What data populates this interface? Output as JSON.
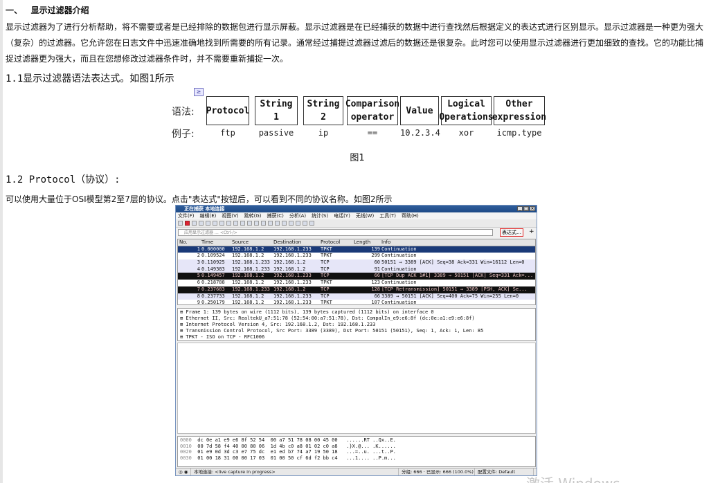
{
  "section": {
    "number": "一、",
    "title": "显示过滤器介绍"
  },
  "intro": "显示过滤器为了进行分析帮助，将不需要或者是已经排除的数据包进行显示屏蔽。显示过滤器是在已经捕获的数据中进行查找然后根据定义的表达式进行区别显示。显示过滤器是一种更为强大（复杂）的过滤器。它允许您在日志文件中迅速准确地找到所需要的所有记录。通常经过捕提过滤器过滤后的数据还是很复杂。此时您可以使用显示过滤器进行更加细致的查找。它的功能比捕捉过滤器更为强大，而且在您想修改过滤器条件时，并不需要重新捕捉一次。",
  "h1_1": "1.1显示过滤器语法表达式。如图1所示",
  "figure1": {
    "syntax_label": "语法:",
    "example_label": "例子:",
    "boxes": [
      {
        "line1": "Protocol",
        "line2": ""
      },
      {
        "line1": "String 1",
        "line2": ""
      },
      {
        "line1": "String 2",
        "line2": ""
      },
      {
        "line1": "Comparison",
        "line2": "operator"
      },
      {
        "line1": "Value",
        "line2": ""
      },
      {
        "line1": "Logical",
        "line2": "Operations"
      },
      {
        "line1": "Other",
        "line2": "expression"
      }
    ],
    "examples": [
      "ftp",
      "passive",
      "ip",
      "==",
      "10.2.3.4",
      "xor",
      "icmp.type"
    ],
    "caption": "图1"
  },
  "h1_2": "1.2 Protocol（协议）:",
  "para2": "可以使用大量位于OSI模型第2至7层的协议。点击\"表达式\"按钮后，可以看到不同的协议名称。如图2所示",
  "wireshark": {
    "title": "正在捕获 本地连接",
    "menu": [
      "文件(F)",
      "编辑(E)",
      "视图(V)",
      "跳转(G)",
      "捕获(C)",
      "分析(A)",
      "统计(S)",
      "电话(Y)",
      "无线(W)",
      "工具(T)",
      "帮助(H)"
    ],
    "filter_placeholder": "应用显示过滤器 … <Ctrl-/>",
    "expr_button": "表达式…",
    "plus": "+",
    "columns": [
      "No.",
      "Time",
      "Source",
      "Destination",
      "Protocol",
      "Length",
      "Info"
    ],
    "packets": [
      {
        "no": "1",
        "time": "0.000000",
        "src": "192.168.1.2",
        "dst": "192.168.1.233",
        "proto": "TPKT",
        "len": "139",
        "info": "Continuation",
        "style": "sel"
      },
      {
        "no": "2",
        "time": "0.109524",
        "src": "192.168.1.2",
        "dst": "192.168.1.233",
        "proto": "TPKT",
        "len": "299",
        "info": "Continuation",
        "style": "tpkt"
      },
      {
        "no": "3",
        "time": "0.110925",
        "src": "192.168.1.233",
        "dst": "192.168.1.2",
        "proto": "TCP",
        "len": "60",
        "info": "50151 → 3389 [ACK] Seq=38 Ack=331 Win=16112 Len=0",
        "style": "tcp"
      },
      {
        "no": "4",
        "time": "0.149383",
        "src": "192.168.1.233",
        "dst": "192.168.1.2",
        "proto": "TCP",
        "len": "91",
        "info": "Continuation",
        "style": "tcp"
      },
      {
        "no": "5",
        "time": "0.149457",
        "src": "192.168.1.2",
        "dst": "192.168.1.233",
        "proto": "TCP",
        "len": "66",
        "info": "[TCP Dup ACK 1#1] 3389 → 50151 [ACK] Seq=331 Ack=...",
        "style": "dark"
      },
      {
        "no": "6",
        "time": "0.218788",
        "src": "192.168.1.2",
        "dst": "192.168.1.233",
        "proto": "TPKT",
        "len": "123",
        "info": "Continuation",
        "style": "tpkt"
      },
      {
        "no": "7",
        "time": "0.237683",
        "src": "192.168.1.233",
        "dst": "192.168.1.2",
        "proto": "TCP",
        "len": "128",
        "info": "[TCP Retransmission] 50151 → 3389 [PSH, ACK] Se...",
        "style": "dark"
      },
      {
        "no": "8",
        "time": "0.237733",
        "src": "192.168.1.2",
        "dst": "192.168.1.233",
        "proto": "TCP",
        "len": "66",
        "info": "3389 → 50151 [ACK] Seq=400 Ack=75 Win=255 Len=0",
        "style": "tcp"
      },
      {
        "no": "9",
        "time": "0.250179",
        "src": "192.168.1.2",
        "dst": "192.168.1.233",
        "proto": "TPKT",
        "len": "107",
        "info": "Continuation",
        "style": "tpkt"
      }
    ],
    "details": [
      "⊞ Frame 1: 139 bytes on wire (1112 bits), 139 bytes captured (1112 bits) on interface 0",
      "⊞ Ethernet II, Src: RealtekU_a7:51:78 (52:54:00:a7:51:78), Dst: CompalIn_e9:e6:8f (dc:0e:a1:e9:e6:8f)",
      "⊞ Internet Protocol Version 4, Src: 192.168.1.2, Dst: 192.168.1.233",
      "⊞ Transmission Control Protocol, Src Port: 3389 (3389), Dst Port: 50151 (50151), Seq: 1, Ack: 1, Len: 85",
      "⊞ TPKT - ISO on TCP - RFC1006"
    ],
    "hex": [
      {
        "off": "0000",
        "bytes": "dc 0e a1 e9 e6 8f 52 54  00 a7 51 78 08 00 45 00",
        "ascii": "......RT ..Qx..E."
      },
      {
        "off": "0010",
        "bytes": "00 7d 58 f4 40 00 80 06  1d 4b c0 a8 01 02 c0 a8",
        "ascii": ".}X.@... .K......"
      },
      {
        "off": "0020",
        "bytes": "01 e9 0d 3d c3 e7 75 dc  e1 ed b7 74 a7 19 50 18",
        "ascii": "...=..u. ...t..P."
      },
      {
        "off": "0030",
        "bytes": "01 00 18 31 00 00 17 03  01 00 50 cf 6d f2 bb c4",
        "ascii": "...1.... ..P.m..."
      }
    ],
    "status": {
      "interface": "本地连接: <live capture in progress>",
      "packets": "分组: 666 · 已显示: 666 (100.0%)",
      "profile": "配置文件: Default"
    }
  },
  "watermark": "激活 Windows"
}
